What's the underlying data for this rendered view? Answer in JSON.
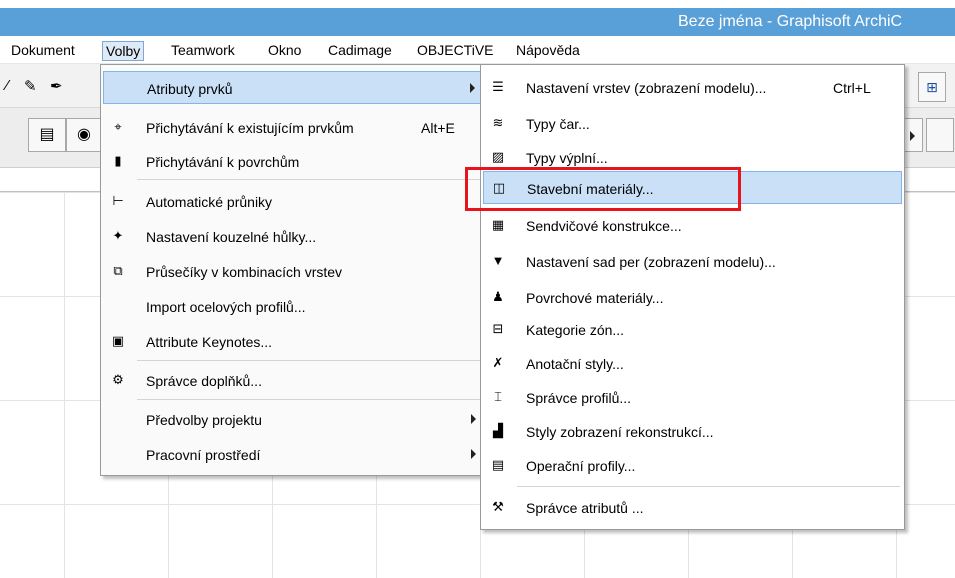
{
  "window": {
    "title": "Beze jména - Graphisoft ArchiC"
  },
  "menubar": {
    "items": [
      "Dokument",
      "Volby",
      "Teamwork",
      "Okno",
      "Cadimage",
      "OBJECTiVE",
      "Nápověda"
    ],
    "active": "Volby"
  },
  "menu_volby": {
    "items": [
      {
        "label": "Atributy prvků",
        "shortcut": "",
        "icon": "none",
        "submenu": true,
        "highlighted": true
      },
      {
        "label": "Přichytávání k existujícím prvkům",
        "shortcut": "Alt+E",
        "icon": "snap-icon"
      },
      {
        "label": "Přichytávání k povrchům",
        "shortcut": "",
        "icon": "surface-snap-icon"
      },
      {
        "label": "Automatické průniky",
        "shortcut": "",
        "icon": "intersection-icon"
      },
      {
        "label": "Nastavení kouzelné hůlky...",
        "shortcut": "",
        "icon": "magic-wand-icon"
      },
      {
        "label": "Průsečíky v kombinacích vrstev",
        "shortcut": "",
        "icon": "layer-intersection-icon"
      },
      {
        "label": "Import ocelových profilů...",
        "shortcut": "",
        "icon": "none"
      },
      {
        "label": "Attribute Keynotes...",
        "shortcut": "",
        "icon": "keynotes-icon"
      },
      {
        "label": "Správce doplňků...",
        "shortcut": "",
        "icon": "addon-manager-icon"
      },
      {
        "label": "Předvolby projektu",
        "shortcut": "",
        "icon": "none",
        "submenu": true
      },
      {
        "label": "Pracovní prostředí",
        "shortcut": "",
        "icon": "none",
        "submenu": true
      }
    ]
  },
  "submenu_atributy": {
    "items": [
      {
        "label": "Nastavení vrstev (zobrazení modelu)...",
        "shortcut": "Ctrl+L",
        "icon": "layers-icon"
      },
      {
        "label": "Typy čar...",
        "icon": "line-types-icon"
      },
      {
        "label": "Typy výplní...",
        "icon": "fill-types-icon"
      },
      {
        "label": "Stavební materiály...",
        "icon": "building-materials-icon",
        "highlighted": true
      },
      {
        "label": "Sendvičové konstrukce...",
        "icon": "composites-icon"
      },
      {
        "label": "Nastavení sad per (zobrazení modelu)...",
        "icon": "pen-sets-icon"
      },
      {
        "label": "Povrchové materiály...",
        "icon": "surface-materials-icon"
      },
      {
        "label": "Kategorie zón...",
        "icon": "zone-categories-icon"
      },
      {
        "label": "Anotační styly...",
        "icon": "annotation-styles-icon"
      },
      {
        "label": "Správce profilů...",
        "icon": "profile-manager-icon"
      },
      {
        "label": "Styly zobrazení rekonstrukcí...",
        "icon": "renovation-styles-icon"
      },
      {
        "label": "Operační profily...",
        "icon": "operation-profiles-icon"
      },
      {
        "label": "Správce atributů ...",
        "icon": "attribute-manager-icon"
      }
    ]
  },
  "colors": {
    "titlebar": "#5aa0d8",
    "menu_highlight": "#c9e0f7",
    "annotation_box": "#e8141b"
  }
}
